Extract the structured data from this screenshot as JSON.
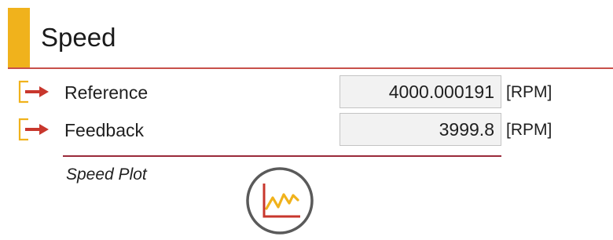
{
  "header": {
    "title": "Speed",
    "accent_color": "#f0b21c",
    "rule_color": "#c8504a"
  },
  "signals": [
    {
      "label": "Reference",
      "value": "4000.000191",
      "unit": "[RPM]",
      "icon": "signal-output-arrow-icon"
    },
    {
      "label": "Feedback",
      "value": "3999.8",
      "unit": "[RPM]",
      "icon": "signal-output-arrow-icon"
    }
  ],
  "plot": {
    "label": "Speed Plot",
    "icon": "line-chart-icon",
    "rule_color": "#9a2a3a"
  },
  "colors": {
    "arrow": "#c8372d",
    "icon_frame": "#f0b21c",
    "plot_circle": "#5a5a5a",
    "plot_axes": "#c8372d",
    "plot_line": "#f0b21c"
  }
}
